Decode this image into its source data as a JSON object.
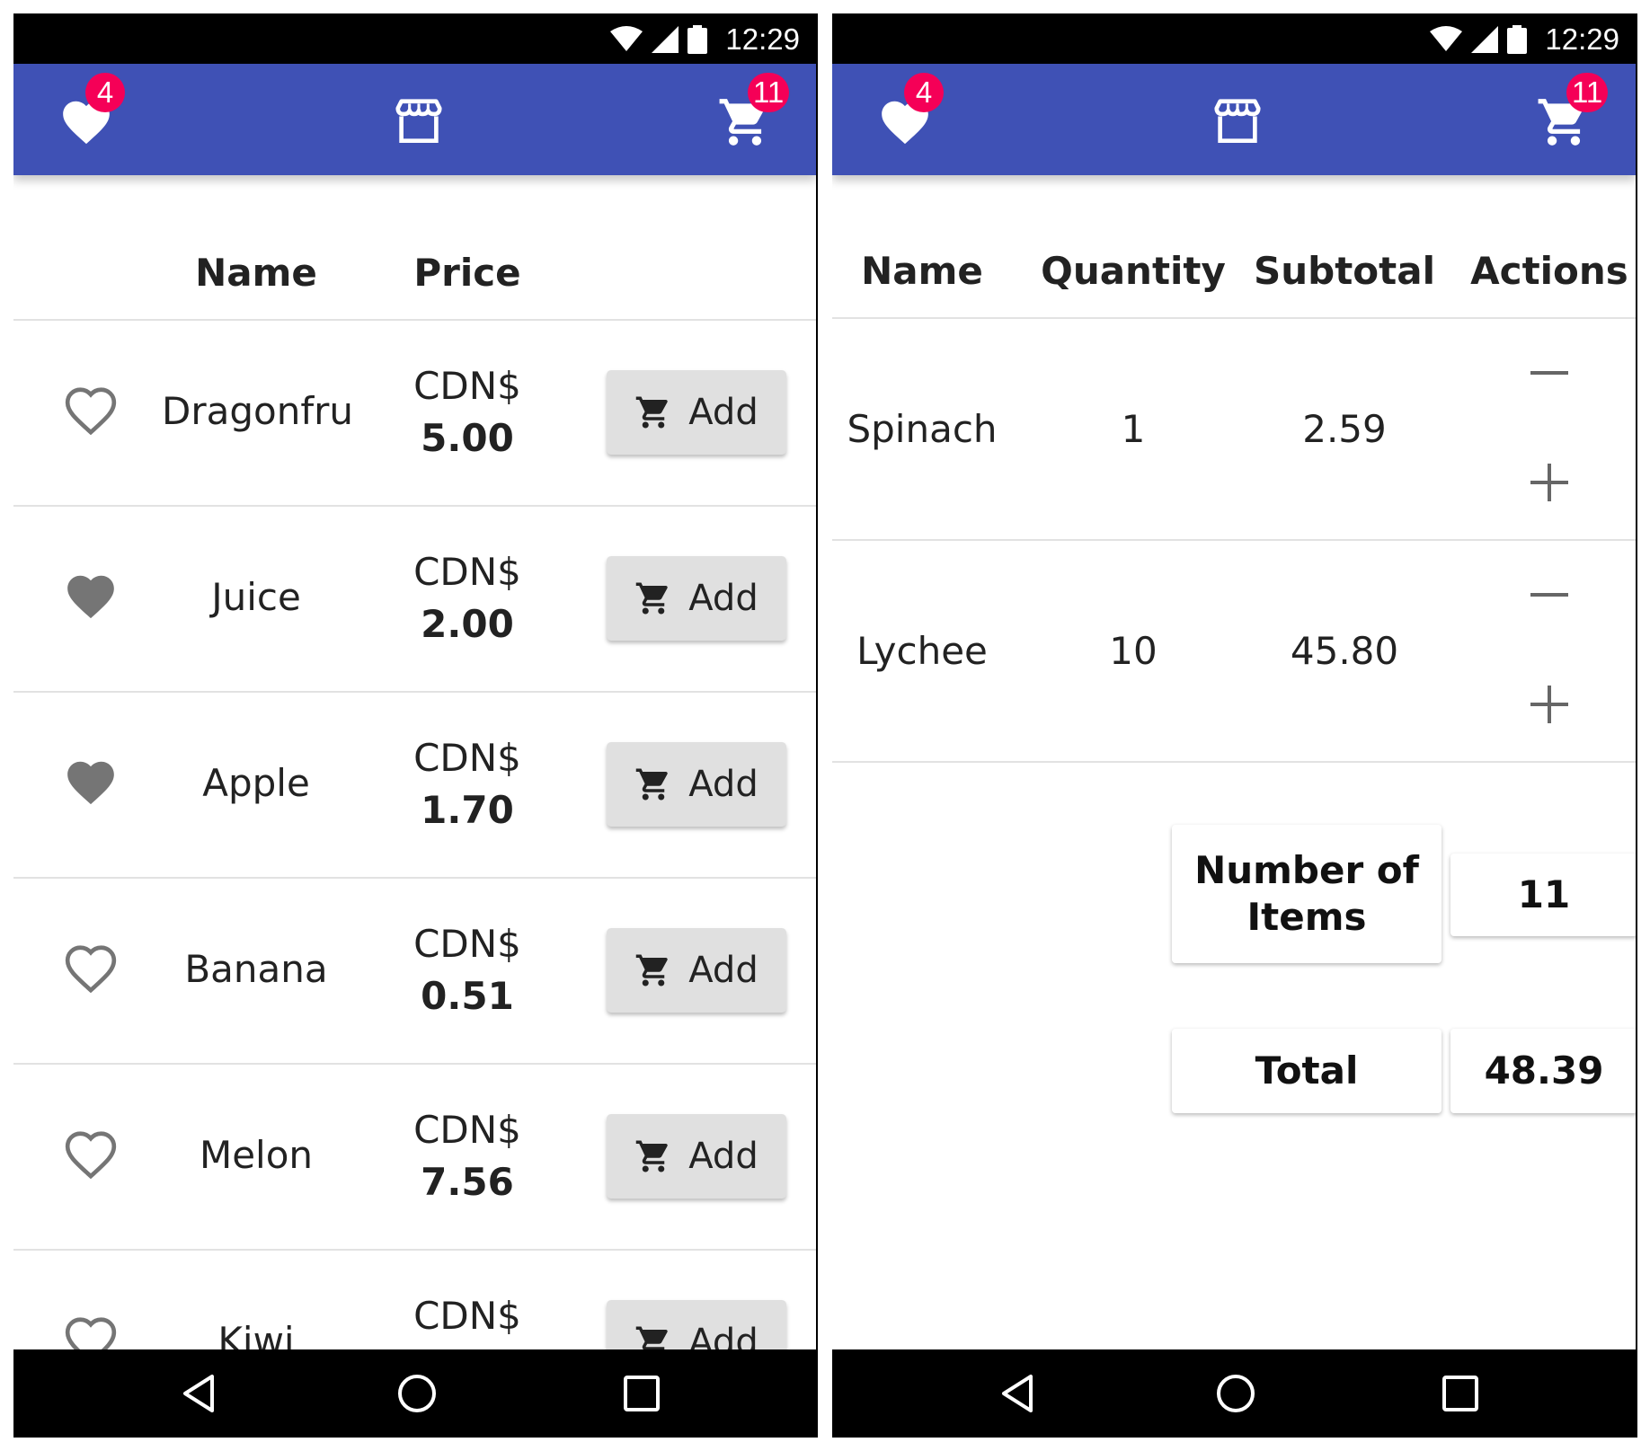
{
  "status_bar": {
    "time": "12:29"
  },
  "app_bar": {
    "favorites_count": "4",
    "cart_count": "11"
  },
  "store": {
    "headers": {
      "name": "Name",
      "price": "Price"
    },
    "products": [
      {
        "name": "Dragonfrui",
        "currency": "CDN$",
        "price": "5.00",
        "favorite": false,
        "button": "Add"
      },
      {
        "name": "Juice",
        "currency": "CDN$",
        "price": "2.00",
        "favorite": true,
        "button": "Add"
      },
      {
        "name": "Apple",
        "currency": "CDN$",
        "price": "1.70",
        "favorite": true,
        "button": "Add"
      },
      {
        "name": "Banana",
        "currency": "CDN$",
        "price": "0.51",
        "favorite": false,
        "button": "Add"
      },
      {
        "name": "Melon",
        "currency": "CDN$",
        "price": "7.56",
        "favorite": false,
        "button": "Add"
      },
      {
        "name": "Kiwi",
        "currency": "CDN$",
        "price": "",
        "favorite": false,
        "button": "Add"
      }
    ]
  },
  "cart": {
    "headers": {
      "name": "Name",
      "quantity": "Quantity",
      "subtotal": "Subtotal",
      "actions": "Actions"
    },
    "items": [
      {
        "name": "Spinach",
        "quantity": "1",
        "subtotal": "2.59"
      },
      {
        "name": "Lychee",
        "quantity": "10",
        "subtotal": "45.80"
      }
    ],
    "summary": {
      "items_label": "Number of Items",
      "items_value": "11",
      "total_label": "Total",
      "total_value": "48.39"
    }
  },
  "colors": {
    "app_bar": "#3f51b5",
    "badge": "#f50057",
    "heart": "#757575",
    "button": "#e0e0e0"
  },
  "icons": [
    "heart-icon",
    "store-icon",
    "cart-icon",
    "heart-outline-icon",
    "minus-icon",
    "plus-icon",
    "back-icon",
    "home-icon",
    "recents-icon",
    "wifi-icon",
    "signal-icon",
    "battery-icon"
  ]
}
